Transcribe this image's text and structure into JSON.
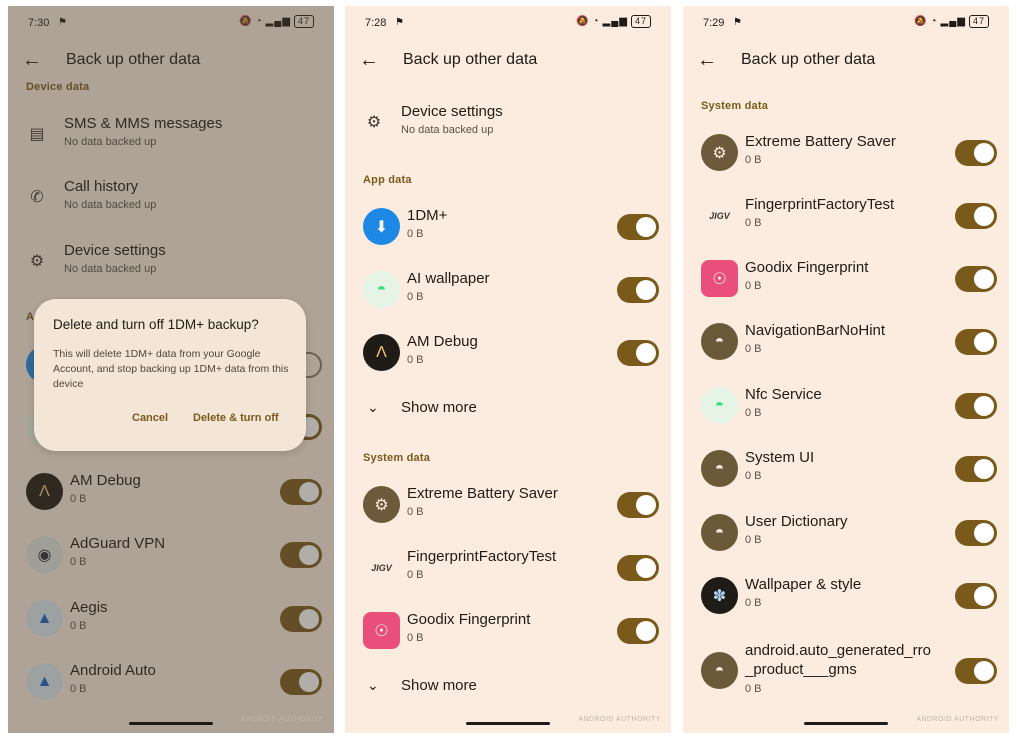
{
  "screen1": {
    "status": {
      "time": "7:30",
      "battery": "47"
    },
    "title": "Back up other data",
    "section_device": "Device data",
    "device_rows": [
      {
        "name": "SMS & MMS messages",
        "sub": "No data backed up",
        "icon": "message-icon"
      },
      {
        "name": "Call history",
        "sub": "No data backed up",
        "icon": "phone-icon"
      },
      {
        "name": "Device settings",
        "sub": "No data backed up",
        "icon": "gear-icon"
      }
    ],
    "section_partial": "A",
    "app_rows": [
      {
        "name": "AM Debug",
        "sub": "0 B"
      },
      {
        "name": "AdGuard VPN",
        "sub": "0 B"
      },
      {
        "name": "Aegis",
        "sub": "0 B"
      },
      {
        "name": "Android Auto",
        "sub": "0 B"
      }
    ],
    "dialog": {
      "title": "Delete and turn off 1DM+ backup?",
      "body": "This will delete 1DM+ data from your Google Account, and stop backing up 1DM+ data from this device",
      "cancel": "Cancel",
      "confirm": "Delete & turn off"
    },
    "watermark": "ANDROID AUTHORITY"
  },
  "screen2": {
    "status": {
      "time": "7:28",
      "battery": "47"
    },
    "title": "Back up other data",
    "device_row": {
      "name": "Device settings",
      "sub": "No data backed up"
    },
    "section_app": "App data",
    "app_rows": [
      {
        "name": "1DM+",
        "sub": "0 B"
      },
      {
        "name": "AI wallpaper",
        "sub": "0 B"
      },
      {
        "name": "AM Debug",
        "sub": "0 B"
      }
    ],
    "show_more": "Show more",
    "section_system": "System data",
    "system_rows": [
      {
        "name": "Extreme Battery Saver",
        "sub": "0 B"
      },
      {
        "name": "FingerprintFactoryTest",
        "sub": "0 B"
      },
      {
        "name": "Goodix Fingerprint",
        "sub": "0 B"
      }
    ],
    "show_more_2": "Show more",
    "watermark": "ANDROID AUTHORITY"
  },
  "screen3": {
    "status": {
      "time": "7:29",
      "battery": "47"
    },
    "title": "Back up other data",
    "section_system": "System data",
    "system_rows": [
      {
        "name": "Extreme Battery Saver",
        "sub": "0 B"
      },
      {
        "name": "FingerprintFactoryTest",
        "sub": "0 B"
      },
      {
        "name": "Goodix Fingerprint",
        "sub": "0 B"
      },
      {
        "name": "NavigationBarNoHint",
        "sub": "0 B"
      },
      {
        "name": "Nfc Service",
        "sub": "0 B"
      },
      {
        "name": "System UI",
        "sub": "0 B"
      },
      {
        "name": "User Dictionary",
        "sub": "0 B"
      },
      {
        "name": "Wallpaper & style",
        "sub": "0 B"
      },
      {
        "name": "android.auto_generated_rro_product___gms",
        "name_line1": "android.auto_generated_rro",
        "name_line2": "_product___gms",
        "sub": "0 B"
      }
    ],
    "watermark": "ANDROID AUTHORITY"
  },
  "colors": {
    "background": "#fcece0",
    "accent": "#7a5a1a",
    "text": "#1f1b16"
  },
  "fp_glyph": "JIGV"
}
